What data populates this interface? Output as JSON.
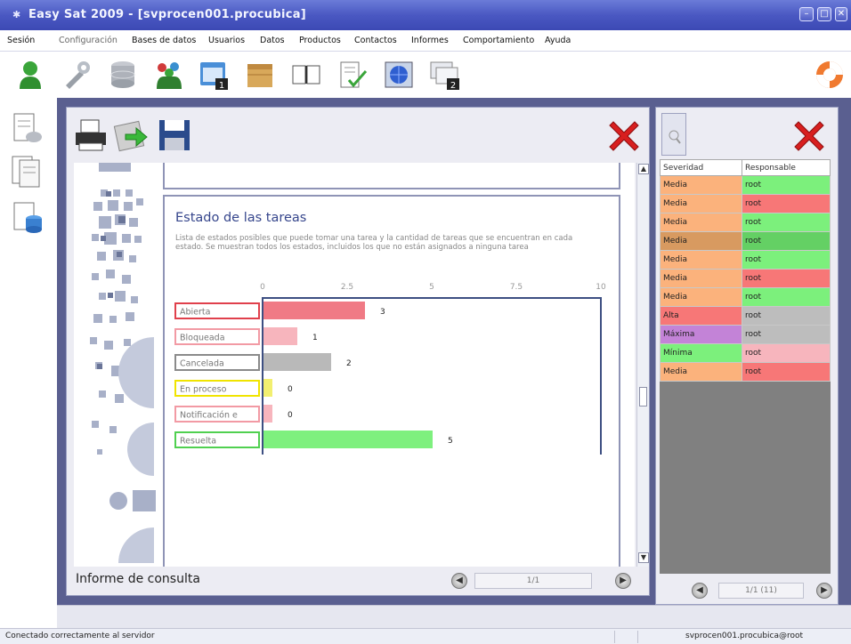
{
  "window": {
    "title": "Easy Sat 2009 - [svprocen001.procubica]",
    "controls": [
      "minimize",
      "maximize",
      "close"
    ]
  },
  "menu": {
    "items": [
      "Sesión",
      "Configuración",
      "Bases de datos",
      "Usuarios",
      "Datos",
      "Productos",
      "Contactos",
      "Informes",
      "Comportamiento",
      "Ayuda"
    ]
  },
  "toolbar": {
    "icons": [
      "user-icon",
      "tools-icon",
      "database-icon",
      "users-group-icon",
      "window-1-icon",
      "box-icon",
      "book-icon",
      "checklist-icon",
      "globe-window-icon",
      "windows-2-icon",
      "lifebuoy-icon"
    ],
    "badges": {
      "window1": "1",
      "windows2": "2"
    }
  },
  "leftbar": {
    "icons": [
      "task-list-icon",
      "document-list-icon",
      "database-list-icon"
    ]
  },
  "report": {
    "tools": [
      "print-icon",
      "export-icon",
      "save-icon",
      "close-icon"
    ],
    "section_title": "Estado de las tareas",
    "section_description": "Lista de estados posibles que puede tomar una tarea y la cantidad de tareas que se encuentran en cada estado. Se muestran todos los estados, incluidos los que no están asignados a ninguna tarea",
    "footer_label": "Informe de consulta",
    "page_indicator": "1/1"
  },
  "chart_data": {
    "type": "bar",
    "orientation": "horizontal",
    "categories": [
      "Abierta",
      "Bloqueada",
      "Cancelada",
      "En proceso",
      "Notificación e",
      "Resuelta"
    ],
    "values": [
      3,
      1,
      2,
      0,
      0,
      5
    ],
    "colors": [
      "#f07a85",
      "#f7b5bd",
      "#b9b9b9",
      "#f2ef70",
      "#f7b5bd",
      "#7ef07e"
    ],
    "label_border_colors": [
      "#e0404c",
      "#f29aa4",
      "#8a8a8a",
      "#f0e400",
      "#f29aa4",
      "#50d050"
    ],
    "x_ticks": [
      "0",
      "2.5",
      "5",
      "7.5",
      "10"
    ],
    "xlim": [
      0,
      10
    ]
  },
  "grid": {
    "headers": [
      "Severidad",
      "Responsable"
    ],
    "rows": [
      {
        "severidad": "Media",
        "responsable": "root",
        "sev_color": "#fbb27c",
        "resp_color": "#7cf07c"
      },
      {
        "severidad": "Media",
        "responsable": "root",
        "sev_color": "#fbb27c",
        "resp_color": "#f77777"
      },
      {
        "severidad": "Media",
        "responsable": "root",
        "sev_color": "#fbb27c",
        "resp_color": "#7cf07c"
      },
      {
        "severidad": "Media",
        "responsable": "root",
        "sev_color": "#d89a60",
        "resp_color": "#64d064"
      },
      {
        "severidad": "Media",
        "responsable": "root",
        "sev_color": "#fbb27c",
        "resp_color": "#7cf07c"
      },
      {
        "severidad": "Media",
        "responsable": "root",
        "sev_color": "#fbb27c",
        "resp_color": "#f77777"
      },
      {
        "severidad": "Media",
        "responsable": "root",
        "sev_color": "#fbb27c",
        "resp_color": "#7cf07c"
      },
      {
        "severidad": "Alta",
        "responsable": "root",
        "sev_color": "#f77777",
        "resp_color": "#bdbdbd"
      },
      {
        "severidad": "Máxima",
        "responsable": "root",
        "sev_color": "#c383d7",
        "resp_color": "#bdbdbd"
      },
      {
        "severidad": "Mínima",
        "responsable": "root",
        "sev_color": "#7cf07c",
        "resp_color": "#f7b5bd"
      },
      {
        "severidad": "Media",
        "responsable": "root",
        "sev_color": "#fbb27c",
        "resp_color": "#f77777"
      }
    ],
    "page_indicator": "1/1 (11)"
  },
  "status": {
    "left": "Conectado correctamente al servidor",
    "right": "svprocen001.procubica@root"
  }
}
